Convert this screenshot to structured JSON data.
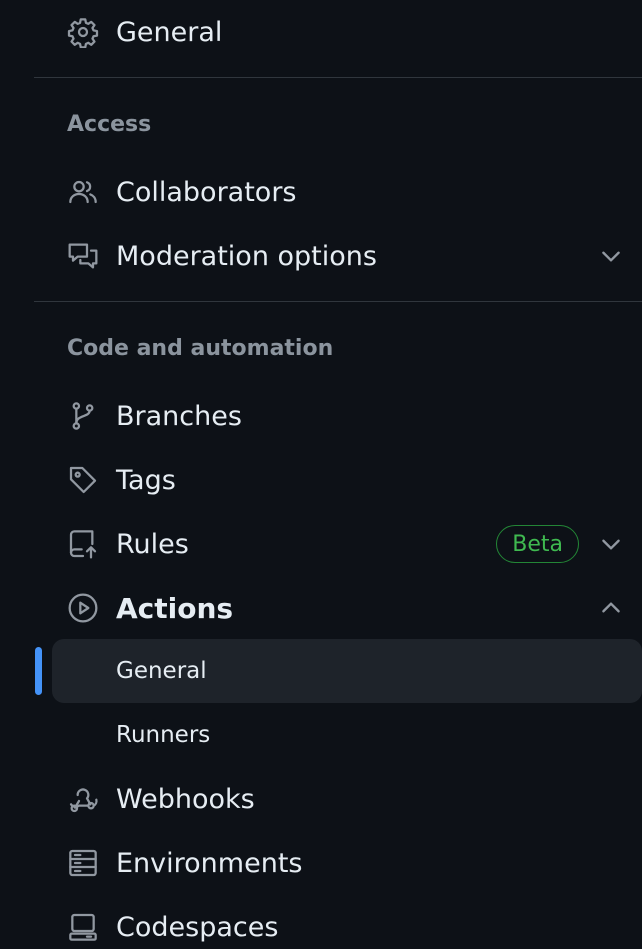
{
  "sidebar": {
    "items": {
      "general": {
        "label": "General",
        "icon": "gear-icon"
      },
      "collaborators": {
        "label": "Collaborators",
        "icon": "people-icon"
      },
      "moderation": {
        "label": "Moderation options",
        "icon": "comment-discussion-icon"
      },
      "branches": {
        "label": "Branches",
        "icon": "git-branch-icon"
      },
      "tags": {
        "label": "Tags",
        "icon": "tag-icon"
      },
      "rules": {
        "label": "Rules",
        "icon": "repo-push-icon",
        "badge": "Beta"
      },
      "actions": {
        "label": "Actions",
        "icon": "play-icon"
      },
      "actions_general": {
        "label": "General"
      },
      "actions_runners": {
        "label": "Runners"
      },
      "webhooks": {
        "label": "Webhooks",
        "icon": "webhook-icon"
      },
      "environments": {
        "label": "Environments",
        "icon": "server-icon"
      },
      "codespaces": {
        "label": "Codespaces",
        "icon": "codespaces-icon"
      }
    },
    "sections": {
      "access": "Access",
      "code_automation": "Code and automation"
    }
  },
  "colors": {
    "background": "#0d1117",
    "active_background": "#1e232a",
    "accent": "#4493f8",
    "badge_green": "#3fb950",
    "muted_text": "#8b949e"
  }
}
